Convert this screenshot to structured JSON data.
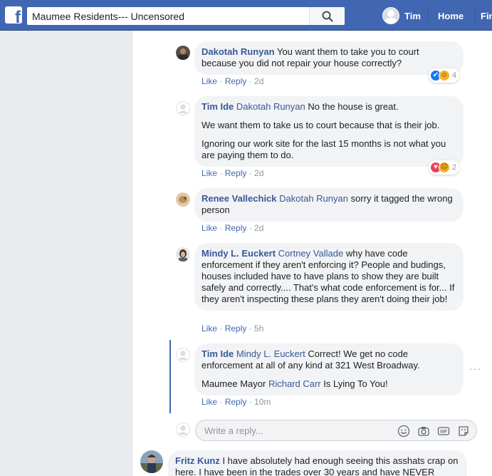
{
  "search": {
    "value": "Maumee Residents--- Uncensored"
  },
  "topbar": {
    "user_name": "Tim",
    "home_label": "Home",
    "find_label": "Fin"
  },
  "comments": [
    {
      "author": "Dakotah Runyan",
      "text": "You want them to take you to court because you did not repair your house correctly?",
      "actions": {
        "like": "Like",
        "reply": "Reply",
        "time": "2d"
      },
      "reaction_count": "4"
    },
    {
      "author": "Tim Ide",
      "tag": "Dakotah Runyan",
      "text": "No the house is great.",
      "para2": "We want them to take us to court because that is their job.",
      "para3": "Ignoring our work site for the last 15 months is not what you are paying them to do.",
      "actions": {
        "like": "Like",
        "reply": "Reply",
        "time": "2d"
      },
      "reaction_count": "2"
    },
    {
      "author": "Renee Vallechick",
      "tag": "Dakotah Runyan",
      "text": "sorry it tagged the wrong person",
      "actions": {
        "like": "Like",
        "reply": "Reply",
        "time": "2d"
      }
    },
    {
      "author": "Mindy L. Euckert",
      "tag": "Cortney Vallade",
      "text": "why have code enforcement if they aren't enforcing it? People and budings, houses included have to have plans to show they are built safely and correctly.... That's what code enforcement is for... If they aren't inspecting these plans they aren't doing their job!",
      "actions": {
        "like": "Like",
        "reply": "Reply",
        "time": "5h"
      }
    },
    {
      "author": "Tim Ide",
      "tag": "Mindy L. Euckert",
      "text": "Correct! We get no code enforcement at all of any kind at 321 West Broadway.",
      "para2_prefix": "Maumee Mayor",
      "para2_tag": "Richard Carr",
      "para2_suffix": "Is Lying To You!",
      "actions": {
        "like": "Like",
        "reply": "Reply",
        "time": "10m"
      }
    }
  ],
  "reply_box": {
    "placeholder": "Write a reply..."
  },
  "next_comment": {
    "author": "Fritz Kunz",
    "text": "I have absolutely had enough seeing this asshats crap on here. I have been in the trades over 30 years and have NEVER"
  },
  "colors": {
    "brand": "#4267b2",
    "link": "#385898",
    "bubble": "#f2f3f5",
    "meta": "#90949c"
  }
}
